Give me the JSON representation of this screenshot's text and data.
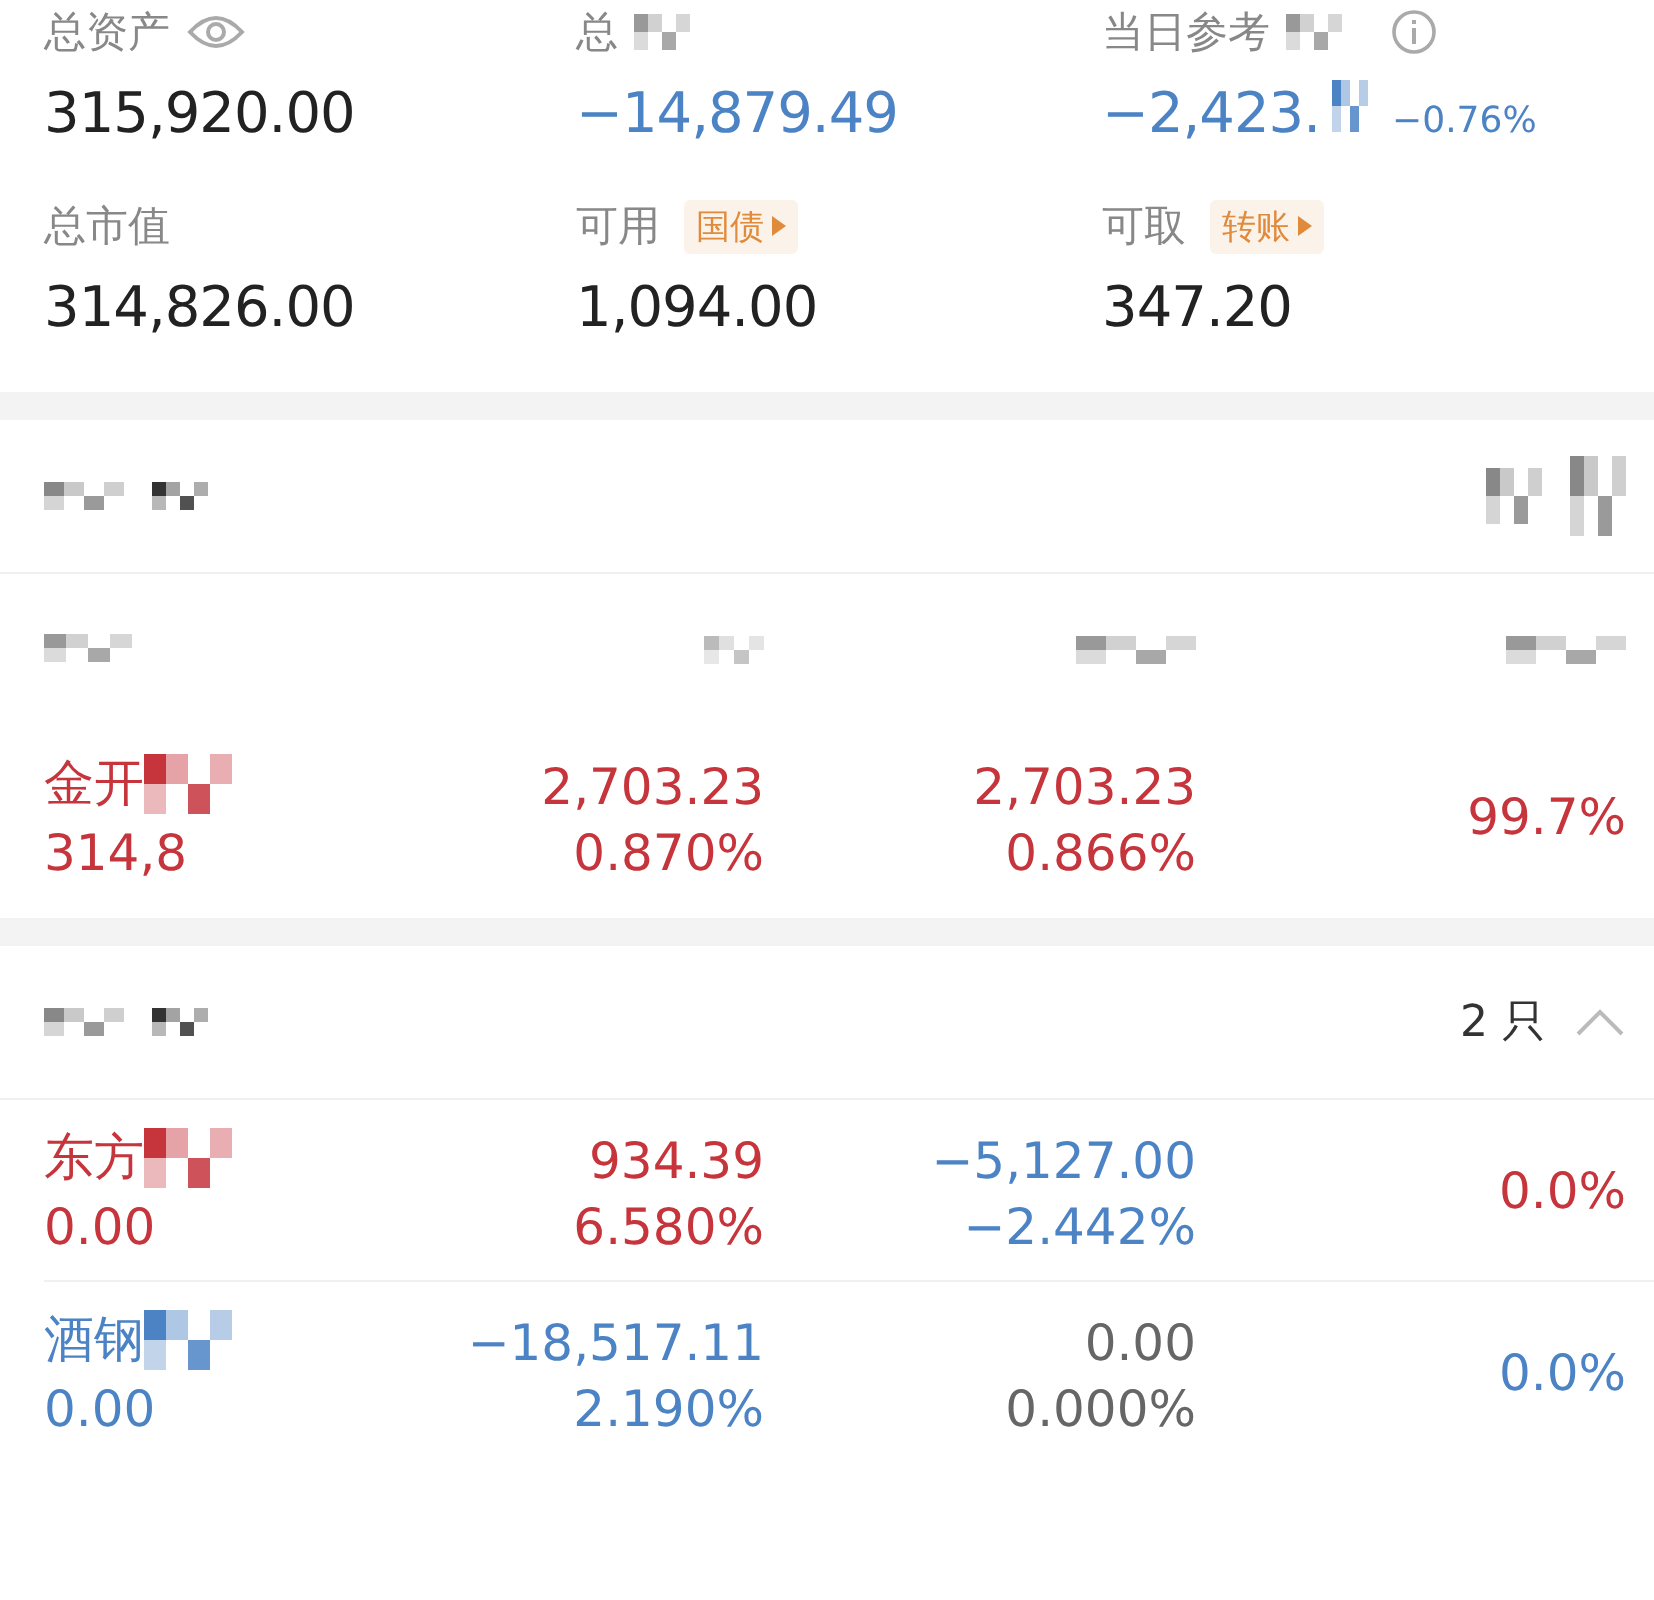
{
  "summary": [
    {
      "label": "总资产",
      "value": {
        "text": "315,920.00",
        "color": "#222222"
      }
    },
    {
      "label": "总",
      "value": {
        "text": "−14,879.49",
        "color": "#4c83c4"
      }
    },
    {
      "label": "当日参考",
      "value": {
        "text": "−2,423.",
        "color": "#4c83c4"
      },
      "change": {
        "text": "−0.76%",
        "color": "#4c83c4"
      }
    },
    {
      "label": "总市值",
      "value": {
        "text": "314,826.00",
        "color": "#222222"
      }
    },
    {
      "label": "可用",
      "tag": "国债",
      "value": {
        "text": "1,094.00",
        "color": "#222222"
      }
    },
    {
      "label": "可取",
      "tag": "转账",
      "value": {
        "text": "347.20",
        "color": "#222222"
      }
    }
  ],
  "sections": [
    {
      "rows": [
        {
          "name": {
            "text": "金开",
            "color": "#c6343c"
          },
          "sub": {
            "text": "314,8",
            "color": "#c6343c"
          },
          "c2": [
            {
              "text": "2,703.23",
              "color": "#c6343c"
            },
            {
              "text": "0.870%",
              "color": "#c6343c"
            }
          ],
          "c3": [
            {
              "text": "2,703.23",
              "color": "#c6343c"
            },
            {
              "text": "0.866%",
              "color": "#c6343c"
            }
          ],
          "c4": {
            "text": "99.7%",
            "color": "#c6343c"
          }
        }
      ]
    },
    {
      "count": "2 只",
      "expanded": true,
      "rows": [
        {
          "name": {
            "text": "东方",
            "color": "#c6343c"
          },
          "sub": {
            "text": "0.00",
            "color": "#c6343c"
          },
          "c2": [
            {
              "text": "934.39",
              "color": "#c6343c"
            },
            {
              "text": "6.580%",
              "color": "#c6343c"
            }
          ],
          "c3": [
            {
              "text": "−5,127.00",
              "color": "#4c83c4"
            },
            {
              "text": "−2.442%",
              "color": "#4c83c4"
            }
          ],
          "c4": {
            "text": "0.0%",
            "color": "#c6343c"
          }
        },
        {
          "name": {
            "text": "酒钢",
            "color": "#4c83c4"
          },
          "sub": {
            "text": "0.00",
            "color": "#4c83c4"
          },
          "c2": [
            {
              "text": "−18,517.11",
              "color": "#4c83c4"
            },
            {
              "text": "2.190%",
              "color": "#4c83c4"
            }
          ],
          "c3": [
            {
              "text": "0.00",
              "color": "#666666"
            },
            {
              "text": "0.000%",
              "color": "#666666"
            }
          ],
          "c4": {
            "text": "0.0%",
            "color": "#4c83c4"
          }
        }
      ]
    }
  ]
}
